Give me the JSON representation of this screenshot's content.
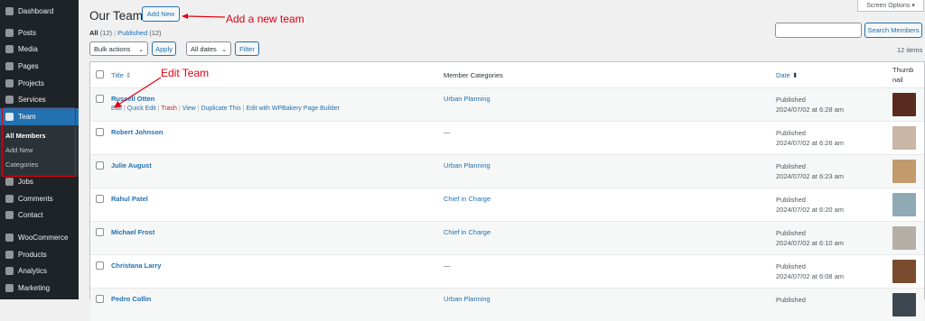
{
  "sidebar": {
    "items": [
      {
        "label": "Dashboard",
        "icon": "dashboard-icon"
      },
      {
        "label": "Posts",
        "icon": "pin-icon"
      },
      {
        "label": "Media",
        "icon": "media-icon"
      },
      {
        "label": "Pages",
        "icon": "pages-icon"
      },
      {
        "label": "Projects",
        "icon": "projects-icon"
      },
      {
        "label": "Services",
        "icon": "services-icon"
      },
      {
        "label": "Team",
        "icon": "team-icon"
      },
      {
        "label": "Jobs",
        "icon": "jobs-icon"
      },
      {
        "label": "Comments",
        "icon": "comments-icon"
      },
      {
        "label": "Contact",
        "icon": "mail-icon"
      },
      {
        "label": "WooCommerce",
        "icon": "woocommerce-icon"
      },
      {
        "label": "Products",
        "icon": "products-icon"
      },
      {
        "label": "Analytics",
        "icon": "analytics-icon"
      },
      {
        "label": "Marketing",
        "icon": "marketing-icon"
      }
    ],
    "submenu": [
      "All Members",
      "Add New",
      "Categories"
    ]
  },
  "header": {
    "title": "Our Team",
    "add_new": "Add New",
    "screen_options": "Screen Options ▾",
    "annotation_add": "Add a new team",
    "annotation_edit": "Edit Team"
  },
  "filters": {
    "all": "All",
    "all_count": "(12)",
    "sep": "|",
    "published": "Published",
    "published_count": "(12)",
    "bulk_actions": "Bulk actions",
    "apply": "Apply",
    "all_dates": "All dates",
    "filter": "Filter",
    "search_button": "Search Members",
    "items_count": "12 items"
  },
  "table": {
    "columns": {
      "title": "Title",
      "categories": "Member Categories",
      "date": "Date",
      "thumb_1": "Thumb",
      "thumb_2": "nail"
    },
    "row_actions": [
      "Edit",
      "Quick Edit",
      "Trash",
      "View",
      "Duplicate This",
      "Edit with WPBakery Page Builder"
    ],
    "rows": [
      {
        "title": "Russell Otten",
        "category": "Urban Planning",
        "status": "Published",
        "date": "2024/07/02 at 6:28 am",
        "thumb_color": "#5a2a1e"
      },
      {
        "title": "Robert Johnson",
        "category": "—",
        "status": "Published",
        "date": "2024/07/02 at 6:26 am",
        "thumb_color": "#c9b6a4"
      },
      {
        "title": "Julie August",
        "category": "Urban Planning",
        "status": "Published",
        "date": "2024/07/02 at 6:23 am",
        "thumb_color": "#c39a6b"
      },
      {
        "title": "Rahul Patel",
        "category": "Chief in Charge",
        "status": "Published",
        "date": "2024/07/02 at 6:20 am",
        "thumb_color": "#8fa9b5"
      },
      {
        "title": "Michael Frost",
        "category": "Chief in Charge",
        "status": "Published",
        "date": "2024/07/02 at 6:10 am",
        "thumb_color": "#b5aea6"
      },
      {
        "title": "Christana Larry",
        "category": "—",
        "status": "Published",
        "date": "2024/07/02 at 6:08 am",
        "thumb_color": "#7a4b2e"
      },
      {
        "title": "Pedro Collin",
        "category": "Urban Planning",
        "status": "Published",
        "date": "",
        "thumb_color": "#3e4650"
      }
    ]
  }
}
